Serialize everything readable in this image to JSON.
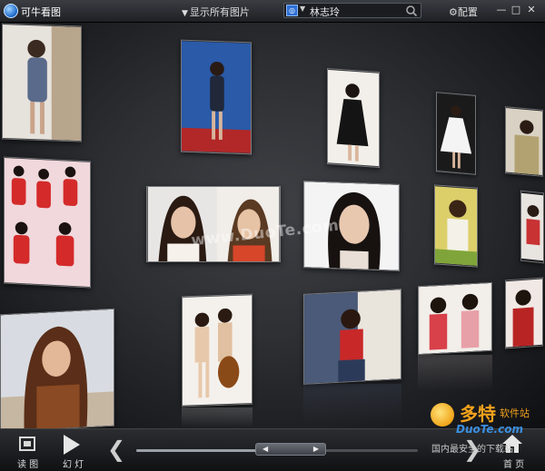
{
  "app": {
    "title": "可牛看图"
  },
  "toolbar_top": {
    "filter_label": "显示所有图片",
    "search_value": "林志玲",
    "config_label": "配置",
    "minimize": "—",
    "maximize": "□",
    "close": "✕"
  },
  "stage": {
    "watermark": "www.DuoTe.com",
    "photo_count": 20
  },
  "corner_logo": {
    "brand": "多特",
    "brand_sub": "软件站",
    "domain": "DuoTe.com",
    "slogan": "国内最安全的下载站"
  },
  "toolbar_bottom": {
    "browse_label": "读 图",
    "slideshow_label": "幻 灯",
    "prev_symbol": "❮",
    "next_symbol": "❯",
    "home_label": "首 页",
    "scroll_left": "◀",
    "scroll_right": "▶",
    "scroll_position": 0.45
  },
  "colors": {
    "background": "#2c2e32",
    "accent_orange": "#f2a21c",
    "accent_blue": "#3b8fe0"
  }
}
